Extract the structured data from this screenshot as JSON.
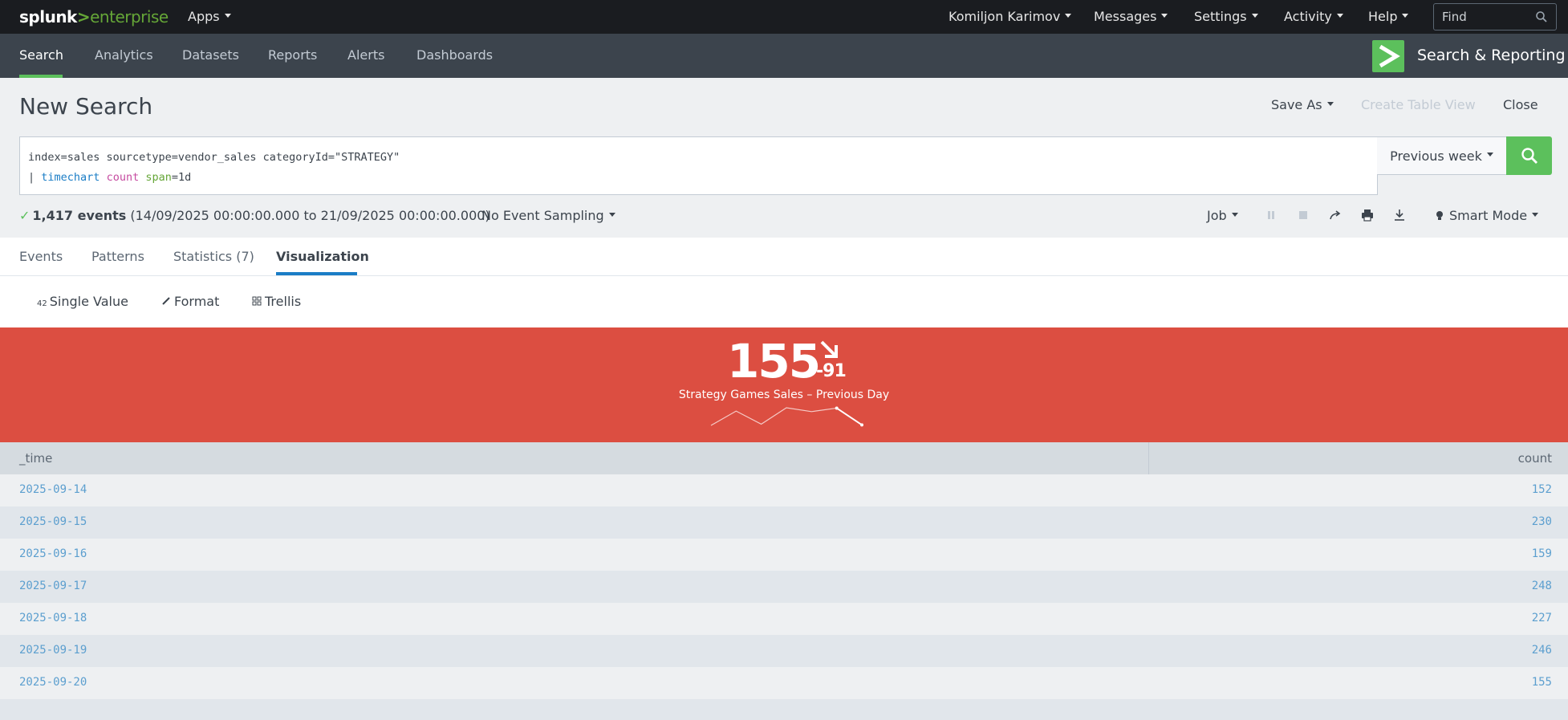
{
  "topbar": {
    "logo_splunk": "splunk",
    "logo_gt": ">",
    "logo_enterprise": "enterprise",
    "apps": "Apps",
    "user": "Komiljon Karimov",
    "messages": "Messages",
    "settings": "Settings",
    "activity": "Activity",
    "help": "Help",
    "find_placeholder": "Find"
  },
  "appbar": {
    "nav": [
      "Search",
      "Analytics",
      "Datasets",
      "Reports",
      "Alerts",
      "Dashboards"
    ],
    "app_title": "Search & Reporting"
  },
  "page": {
    "title": "New Search",
    "save_as": "Save As",
    "create_table_view": "Create Table View",
    "close": "Close"
  },
  "search": {
    "line1": "index=sales sourcetype=vendor_sales categoryId=\"STRATEGY\"",
    "pipe": "| ",
    "cmd": "timechart",
    "fn": "count",
    "arg": "span",
    "arg_val": "=1d",
    "time_range": "Previous week"
  },
  "status": {
    "events": "1,417 events",
    "range": "(14/09/2025 00:00:00.000 to 21/09/2025 00:00:00.000)",
    "sampling": "No Event Sampling",
    "job": "Job",
    "mode": "Smart Mode"
  },
  "tabs": [
    "Events",
    "Patterns",
    "Statistics (7)",
    "Visualization"
  ],
  "viz_toolbar": {
    "single_value_icon_text": "42",
    "single_value": "Single Value",
    "format": "Format",
    "trellis": "Trellis"
  },
  "single_value": {
    "value": "155",
    "delta": "-91",
    "label": "Strategy Games Sales – Previous Day",
    "color": "#dc4e41",
    "sparkline": [
      152,
      230,
      159,
      248,
      227,
      246,
      155
    ]
  },
  "table": {
    "columns": [
      "_time",
      "count"
    ],
    "rows": [
      [
        "2025-09-14",
        "152"
      ],
      [
        "2025-09-15",
        "230"
      ],
      [
        "2025-09-16",
        "159"
      ],
      [
        "2025-09-17",
        "248"
      ],
      [
        "2025-09-18",
        "227"
      ],
      [
        "2025-09-19",
        "246"
      ],
      [
        "2025-09-20",
        "155"
      ]
    ]
  }
}
